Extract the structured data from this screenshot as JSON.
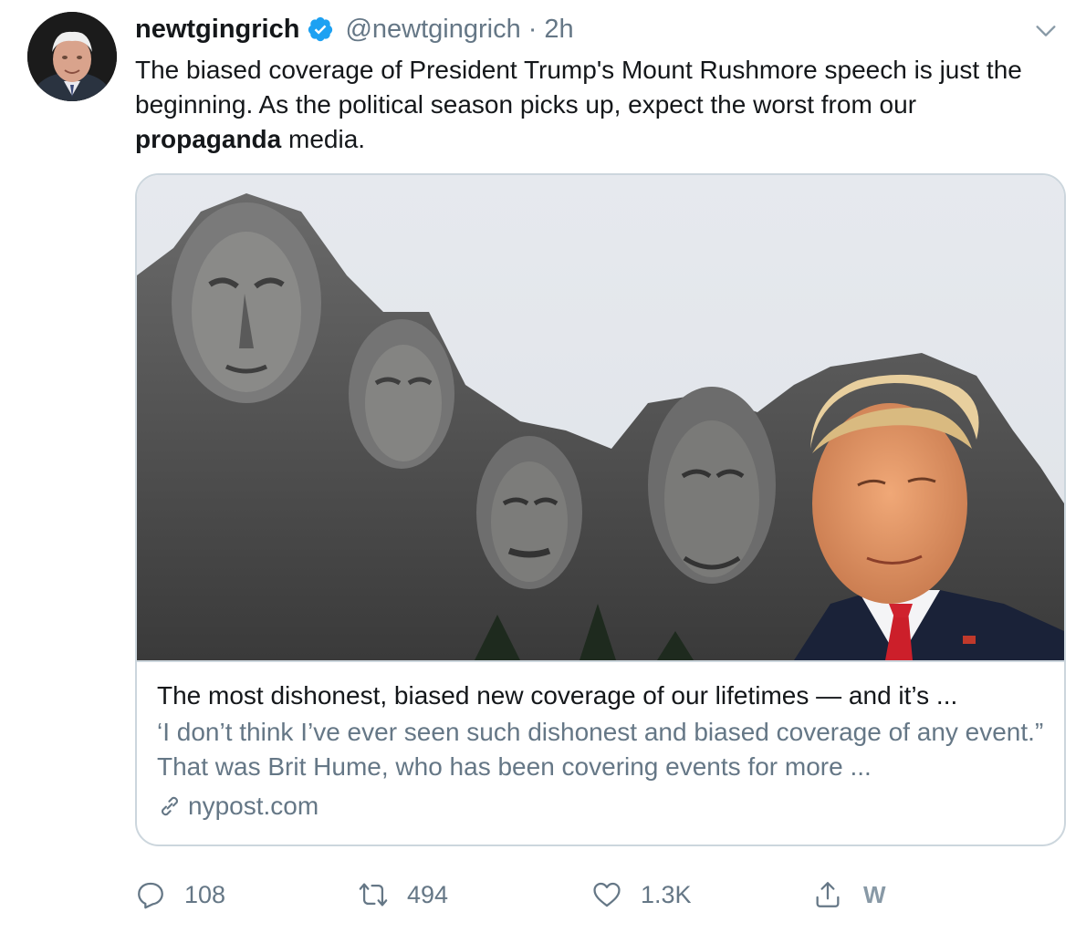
{
  "tweet": {
    "display_name": "newtgingrich",
    "handle": "@newtgingrich",
    "separator": "·",
    "time": "2h",
    "verified": true,
    "text_part1": "The biased coverage of President Trump's Mount Rushmore speech is just the beginning. As the political season picks up, expect the worst from our ",
    "text_bold": "propaganda",
    "text_part2": " media."
  },
  "card": {
    "title": "The most dishonest, biased new coverage of our lifetimes — and it’s ...",
    "description": "‘I don’t think I’ve ever seen such dishonest and biased coverage of any event.” That was Brit Hume, who has been covering events for more ...",
    "domain": "nypost.com"
  },
  "actions": {
    "replies": "108",
    "retweets": "494",
    "likes": "1.3K",
    "extension_label": "W"
  },
  "icons": {
    "verified": "verified-badge-icon",
    "more": "chevron-down-icon",
    "link": "link-icon",
    "reply": "reply-icon",
    "retweet": "retweet-icon",
    "like": "heart-icon",
    "share": "share-icon"
  },
  "colors": {
    "accent": "#1da1f2",
    "text": "#14171a",
    "secondary": "#657786",
    "border": "#ccd6dd"
  }
}
